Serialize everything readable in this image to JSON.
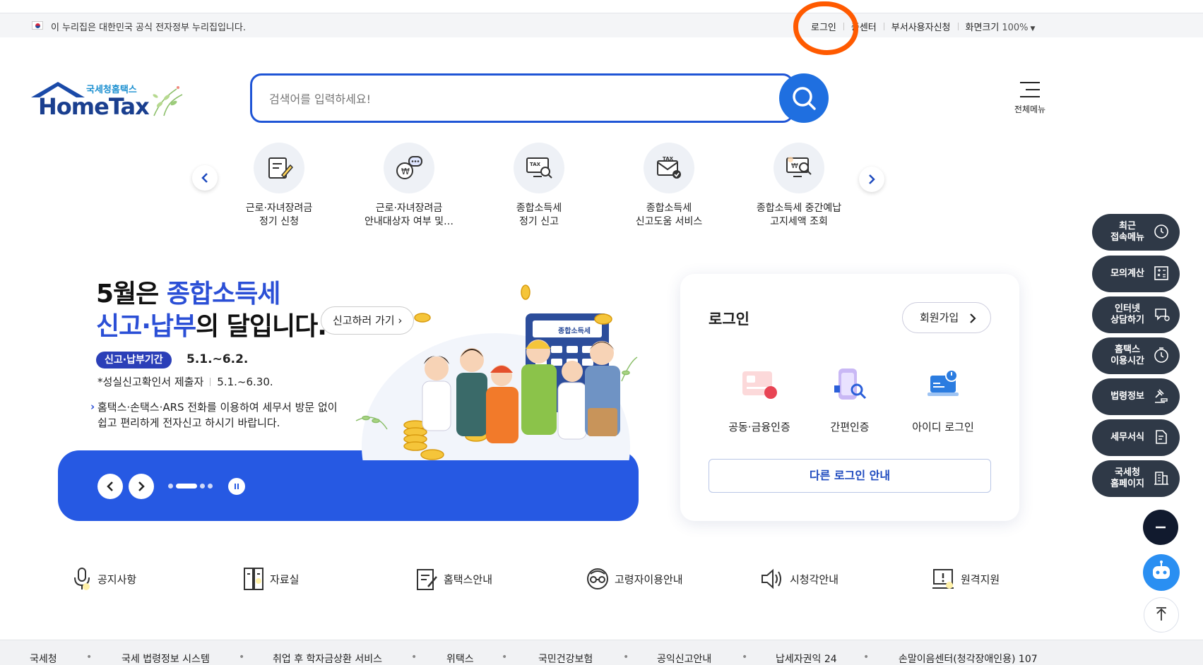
{
  "topbar": {
    "gov_notice": "이 누리집은 대한민국 공식 전자정부 누리집입니다.",
    "login": "로그인",
    "cert_center": "증센터",
    "dept_user": "부서사용자신청",
    "zoom_label": "화면크기",
    "zoom_value": "100%",
    "annotation_color": "#ff5a00"
  },
  "header": {
    "logo_sub": "국세청홈택스",
    "logo_main": "HomeTax",
    "search_placeholder": "검색어를 입력하세요!",
    "all_menu": "전체메뉴"
  },
  "quick_services": [
    {
      "line1": "근로·자녀장려금",
      "line2": "정기 신청",
      "icon": "form-edit-icon"
    },
    {
      "line1": "근로·자녀장려금",
      "line2": "안내대상자 여부 및…",
      "icon": "money-bag-chat-icon"
    },
    {
      "line1": "종합소득세",
      "line2": "정기 신고",
      "icon": "tax-monitor-icon"
    },
    {
      "line1": "종합소득세",
      "line2": "신고도움 서비스",
      "icon": "tax-envelope-check-icon"
    },
    {
      "line1": "종합소득세 중간예납",
      "line2": "고지세액 조회",
      "icon": "tax-search-monitor-icon"
    }
  ],
  "banner": {
    "line1_a": "5월은 ",
    "line1_b": "종합소득세",
    "line2_a": "신고·납부",
    "line2_b": "의 달입니다.",
    "go_button": "신고하러 가기",
    "period_tag": "신고·납부기간",
    "period": "5.1.~6.2.",
    "faithful_label": "*성실신고확인서 제출자",
    "faithful_period": "5.1.~6.30.",
    "ars_line1": "홈택스·손택스·ARS 전화를 이용하여 세무서 방문 없이",
    "ars_line2": "쉽고 편리하게 전자신고 하시기 바랍니다.",
    "calculator_label": "종합소득세",
    "slide_count": 4,
    "active_slide": 2
  },
  "login_card": {
    "title": "로그인",
    "join": "회원가입",
    "options": [
      "공동·금융인증",
      "간편인증",
      "아이디 로그인"
    ],
    "other": "다른 로그인 안내"
  },
  "quick_links": [
    "공지사항",
    "자료실",
    "홈택스안내",
    "고령자이용안내",
    "시청각안내",
    "원격지원"
  ],
  "floating_menu": [
    {
      "l1": "최근",
      "l2": "접속메뉴",
      "icon": "clock-icon"
    },
    {
      "l1": "모의계산",
      "l2": "",
      "icon": "calculator-icon"
    },
    {
      "l1": "인터넷",
      "l2": "상담하기",
      "icon": "chat-icon"
    },
    {
      "l1": "홈택스",
      "l2": "이용시간",
      "icon": "timer-icon"
    },
    {
      "l1": "법령정보",
      "l2": "",
      "icon": "gavel-icon"
    },
    {
      "l1": "세무서식",
      "l2": "",
      "icon": "document-icon"
    },
    {
      "l1": "국세청",
      "l2": "홈페이지",
      "icon": "building-icon"
    }
  ],
  "footer": [
    "국세청",
    "국세 법령정보 시스템",
    "취업 후 학자금상환 서비스",
    "위택스",
    "국민건강보험",
    "공익신고안내",
    "납세자권익 24",
    "손말이음센터(청각장애인용) 107"
  ],
  "colors": {
    "brand_blue": "#1f55d6",
    "banner_blue": "#2659e3",
    "floating_dark": "#2f3947"
  }
}
